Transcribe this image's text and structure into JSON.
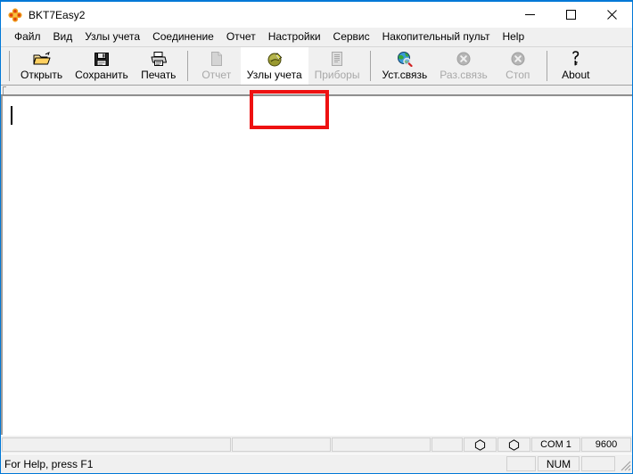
{
  "window": {
    "title": "BKT7Easy2",
    "app_icon": "flower-icon",
    "border_color": "#0078D7",
    "controls": {
      "minimize": "minimize-icon",
      "maximize": "maximize-icon",
      "close": "close-icon"
    }
  },
  "menubar": {
    "items": [
      {
        "label": "Файл"
      },
      {
        "label": "Вид"
      },
      {
        "label": "Узлы учета"
      },
      {
        "label": "Соединение"
      },
      {
        "label": "Отчет"
      },
      {
        "label": "Настройки"
      },
      {
        "label": "Сервис"
      },
      {
        "label": "Накопительный пульт"
      },
      {
        "label": "Help"
      }
    ]
  },
  "toolbar": {
    "buttons": [
      {
        "label": "Открыть",
        "icon": "open-folder-icon",
        "enabled": true,
        "highlighted": false
      },
      {
        "label": "Сохранить",
        "icon": "floppy-save-icon",
        "enabled": true,
        "highlighted": false
      },
      {
        "label": "Печать",
        "icon": "printer-icon",
        "enabled": true,
        "highlighted": false
      },
      {
        "label": "Отчет",
        "icon": "document-icon",
        "enabled": false,
        "highlighted": false
      },
      {
        "label": "Узлы учета",
        "icon": "metering-node-icon",
        "enabled": true,
        "highlighted": true
      },
      {
        "label": "Приборы",
        "icon": "device-list-icon",
        "enabled": false,
        "highlighted": false
      },
      {
        "label": "Уст.связь",
        "icon": "globe-search-icon",
        "enabled": true,
        "highlighted": false
      },
      {
        "label": "Раз.связь",
        "icon": "disconnect-icon",
        "enabled": false,
        "highlighted": false
      },
      {
        "label": "Стоп",
        "icon": "stop-icon",
        "enabled": false,
        "highlighted": false
      },
      {
        "label": "About",
        "icon": "help-key-icon",
        "enabled": true,
        "highlighted": false
      }
    ],
    "annotation": {
      "target_label": "Узлы учета",
      "color": "#ee1111"
    }
  },
  "status_panels": {
    "rx_led": "led-indicator",
    "tx_led": "led-indicator",
    "com_port": "COM 1",
    "baud_rate": "9600"
  },
  "statusbar": {
    "message": "For Help, press F1",
    "pane_blank_1": "",
    "num_lock": "NUM",
    "pane_blank_2": "",
    "resize_grip": "resize-grip-icon"
  }
}
